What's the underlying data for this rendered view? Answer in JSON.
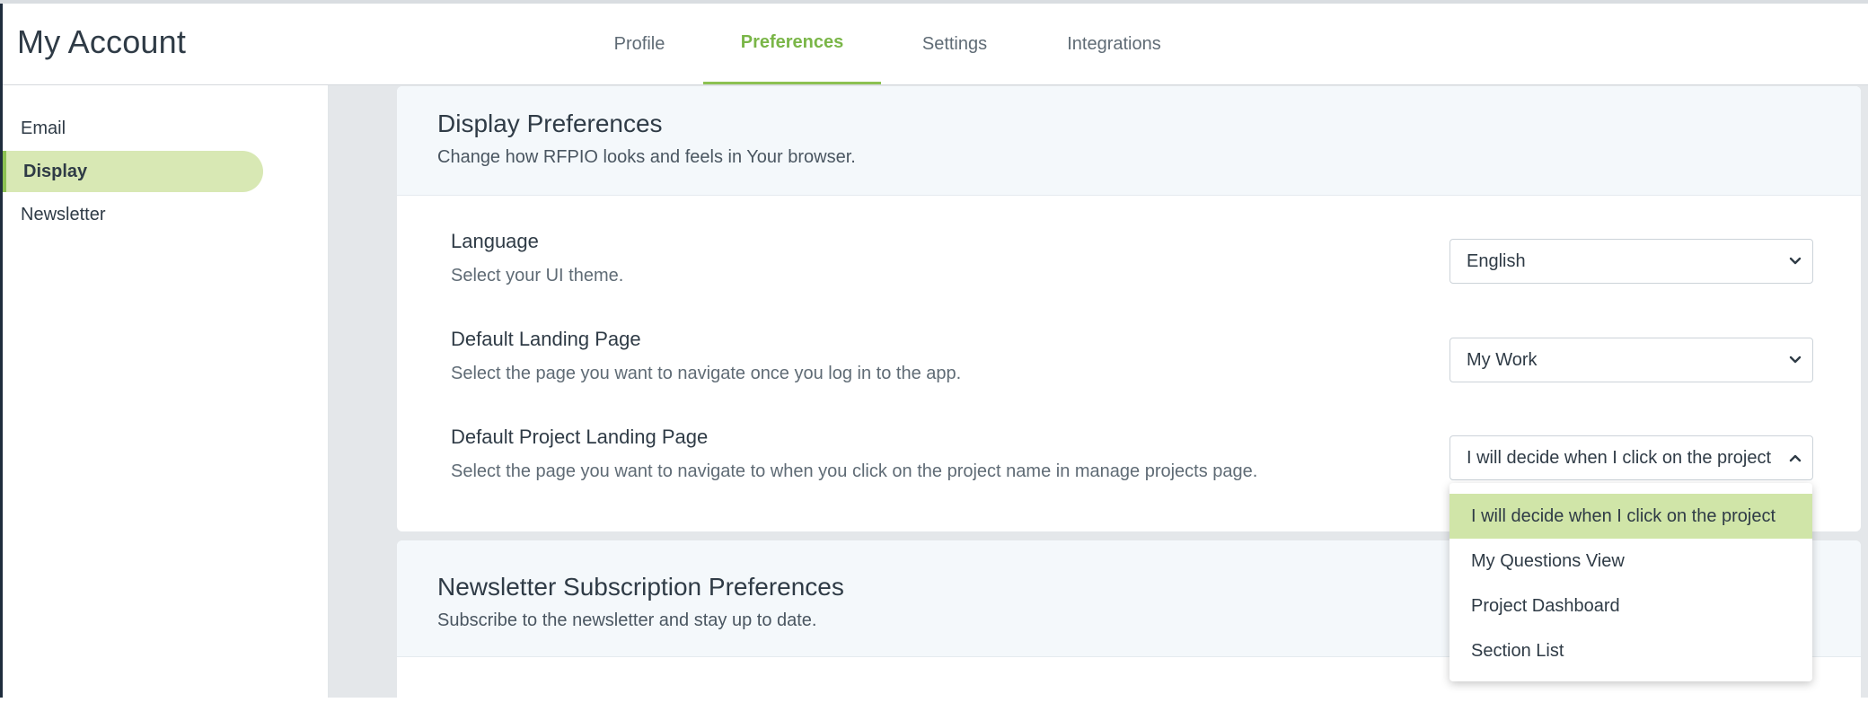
{
  "header": {
    "title": "My Account",
    "tabs": [
      {
        "label": "Profile"
      },
      {
        "label": "Preferences",
        "active": true
      },
      {
        "label": "Settings"
      },
      {
        "label": "Integrations"
      }
    ]
  },
  "sidebar": {
    "items": [
      {
        "label": "Email"
      },
      {
        "label": "Display",
        "active": true
      },
      {
        "label": "Newsletter"
      }
    ]
  },
  "display_card": {
    "title": "Display Preferences",
    "subtitle": "Change how RFPIO looks and feels in Your browser.",
    "prefs": [
      {
        "label": "Language",
        "description": "Select your UI theme.",
        "value": "English",
        "icon": "chevron-down-icon"
      },
      {
        "label": "Default Landing Page",
        "description": "Select the page you want to navigate once you log in to the app.",
        "value": "My Work",
        "icon": "chevron-down-icon"
      },
      {
        "label": "Default Project Landing Page",
        "description": "Select the page you want to navigate to when you click on the project name in manage projects page.",
        "value": "I will decide when I click on the project",
        "icon": "chevron-up-icon"
      }
    ]
  },
  "newsletter_card": {
    "title": "Newsletter Subscription Preferences",
    "subtitle": "Subscribe to the newsletter and stay up to date."
  },
  "dropdown": {
    "options": [
      {
        "label": "I will decide when I click on the project",
        "selected": true
      },
      {
        "label": "My Questions View"
      },
      {
        "label": "Project Dashboard"
      },
      {
        "label": "Section List"
      }
    ]
  },
  "colors": {
    "accent": "#8cc152",
    "accent_text": "#7ab648",
    "selected_bg": "#d8e8b4",
    "page_bg": "#e4e7ea"
  }
}
